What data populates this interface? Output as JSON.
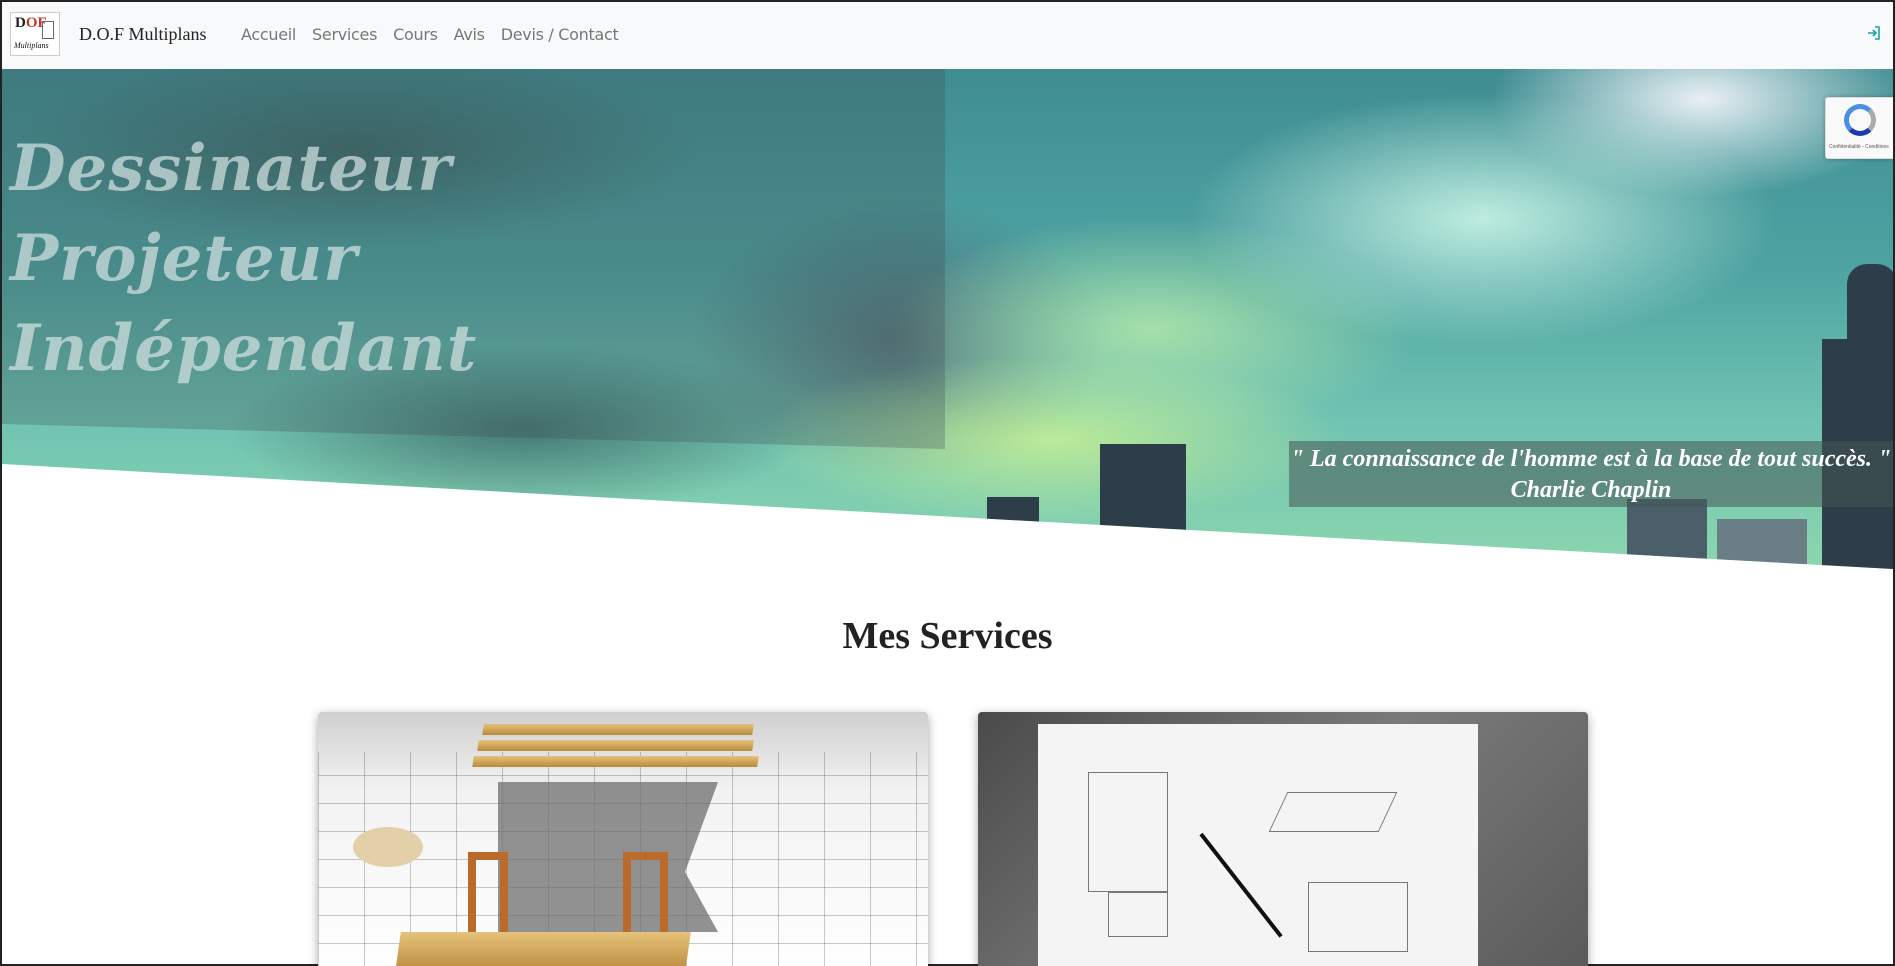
{
  "navbar": {
    "logo": {
      "line1_a": "D",
      "line1_b": "OF",
      "line2": "Multiplans"
    },
    "brand": "D.O.F Multiplans",
    "links": [
      "Accueil",
      "Services",
      "Cours",
      "Avis",
      "Devis / Contact"
    ],
    "login_icon": "sign-in-icon"
  },
  "hero": {
    "title_line1": "Dessinateur Projeteur",
    "title_line2": "Indépendant",
    "quote": "\" La connaissance de l'homme est à la base de tout succès. \"",
    "author": "Charlie Chaplin"
  },
  "recaptcha": {
    "text": "Confidentialité - Conditions"
  },
  "services": {
    "title": "Mes Services",
    "cards": [
      {
        "image": "architectural-plan-3d-model"
      },
      {
        "image": "sketchbook-pencil-drawing"
      }
    ]
  },
  "colors": {
    "accent": "#1aa3a3",
    "nav_bg": "#f8f9fa",
    "nav_text": "#777777"
  }
}
